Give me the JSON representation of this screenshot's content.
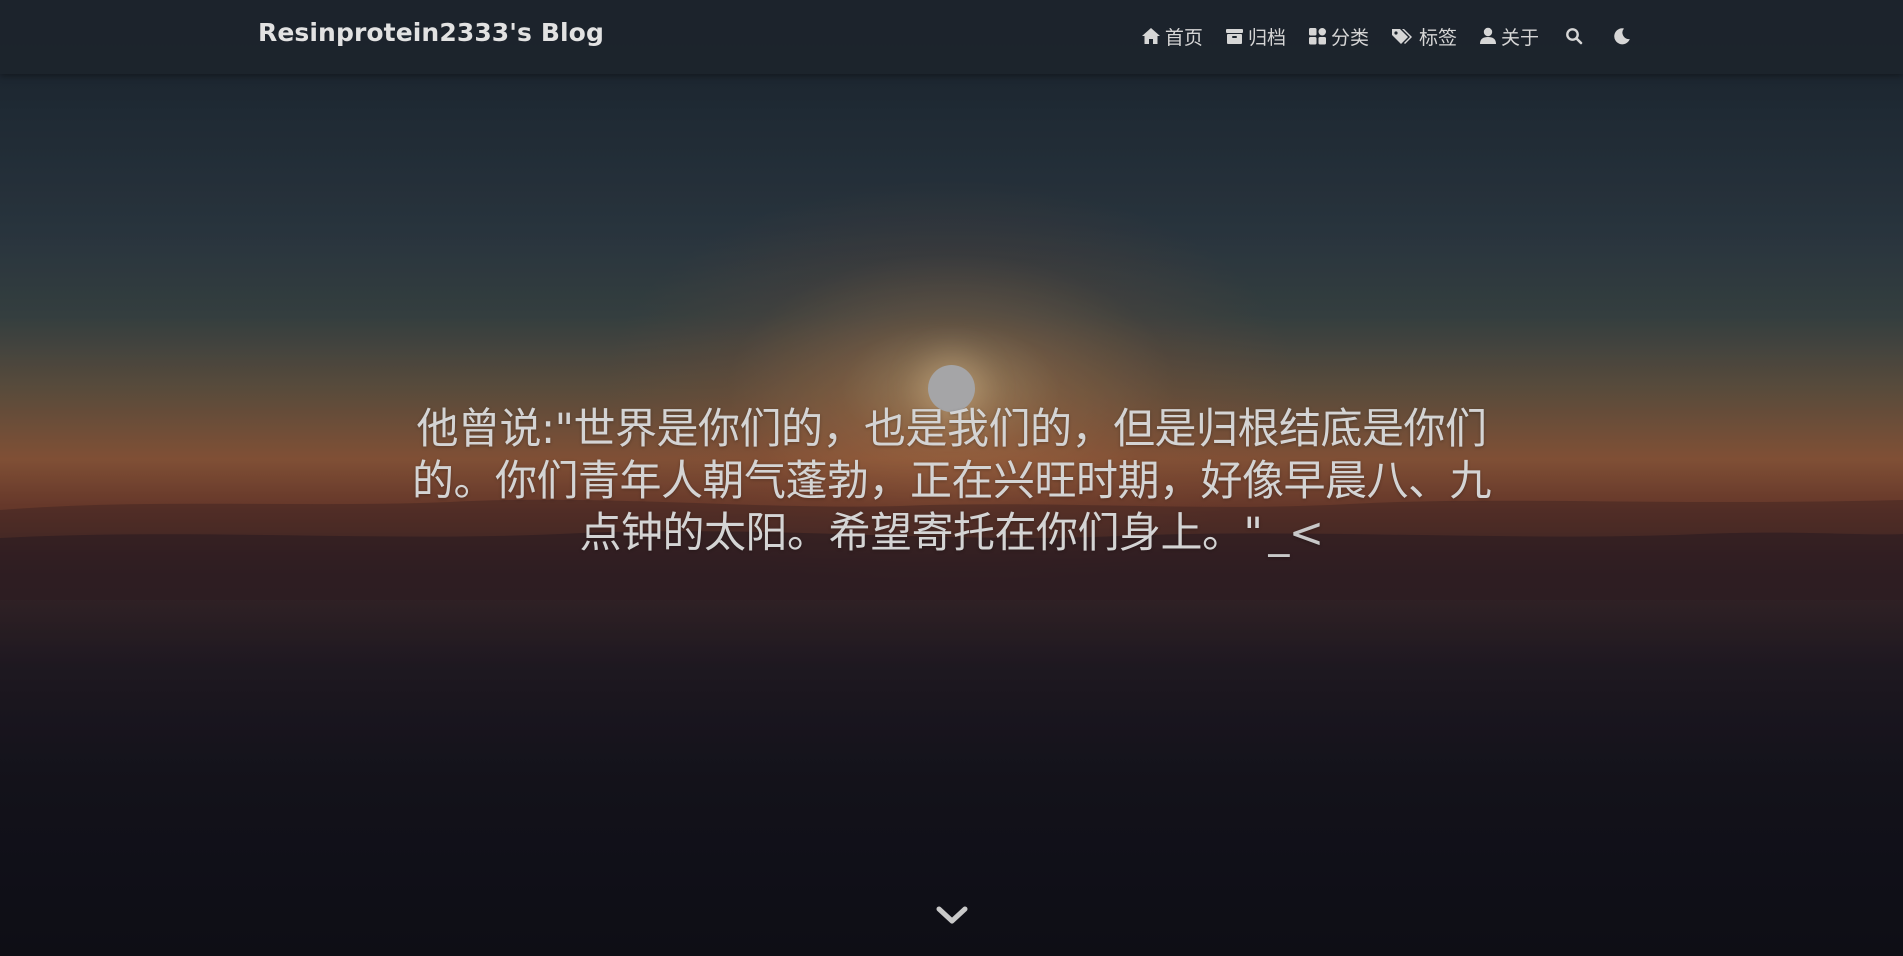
{
  "brand": {
    "title": "Resinprotein2333's Blog"
  },
  "nav": {
    "items": [
      {
        "label": "首页",
        "icon": "home-icon"
      },
      {
        "label": "归档",
        "icon": "archive-icon"
      },
      {
        "label": "分类",
        "icon": "category-icon"
      },
      {
        "label": "标签",
        "icon": "tags-icon"
      },
      {
        "label": "关于",
        "icon": "user-icon"
      }
    ],
    "search_icon": "search-icon",
    "theme_icon": "moon-icon"
  },
  "hero": {
    "slogan": "他曾说:\"世界是你们的，也是我们的，但是归根结底是你们的。你们青年人朝气蓬勃，正在兴旺时期，好像早晨八、九点钟的太阳。希望寄托在你们身上。\"",
    "cursor": "_<",
    "scroll_icon": "chevron-down-icon"
  },
  "colors": {
    "navbar_bg": "#1c242c",
    "text": "#d4d4d4",
    "sun": "#c7c7c9"
  }
}
